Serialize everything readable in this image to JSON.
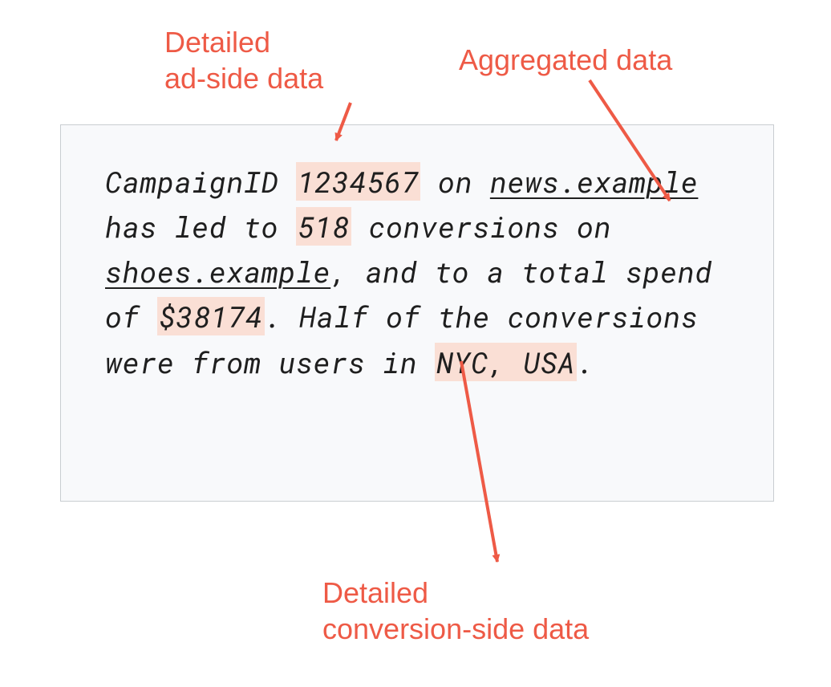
{
  "labels": {
    "ad_side": {
      "l1": "Detailed",
      "l2": "ad-side data"
    },
    "aggregated": "Aggregated data",
    "conv_side": {
      "l1": "Detailed",
      "l2": "conversion-side data"
    }
  },
  "text": {
    "t1": "CampaignID ",
    "campaign_id": "1234567",
    "t2": " on ",
    "site1": "news.example",
    "t3": " has led to ",
    "conv_count": "518",
    "t4": " conversions on ",
    "site2": "shoes.example",
    "t5": ", and to a total spend of ",
    "spend": "$38174",
    "t6": ". Half of the conversions were from users in ",
    "geo": "NYC, USA",
    "t7": "."
  },
  "colors": {
    "accent": "#ee5a46",
    "highlight": "#fadfd5",
    "box_bg": "#f8f9fb",
    "box_border": "#c9cdd1"
  }
}
